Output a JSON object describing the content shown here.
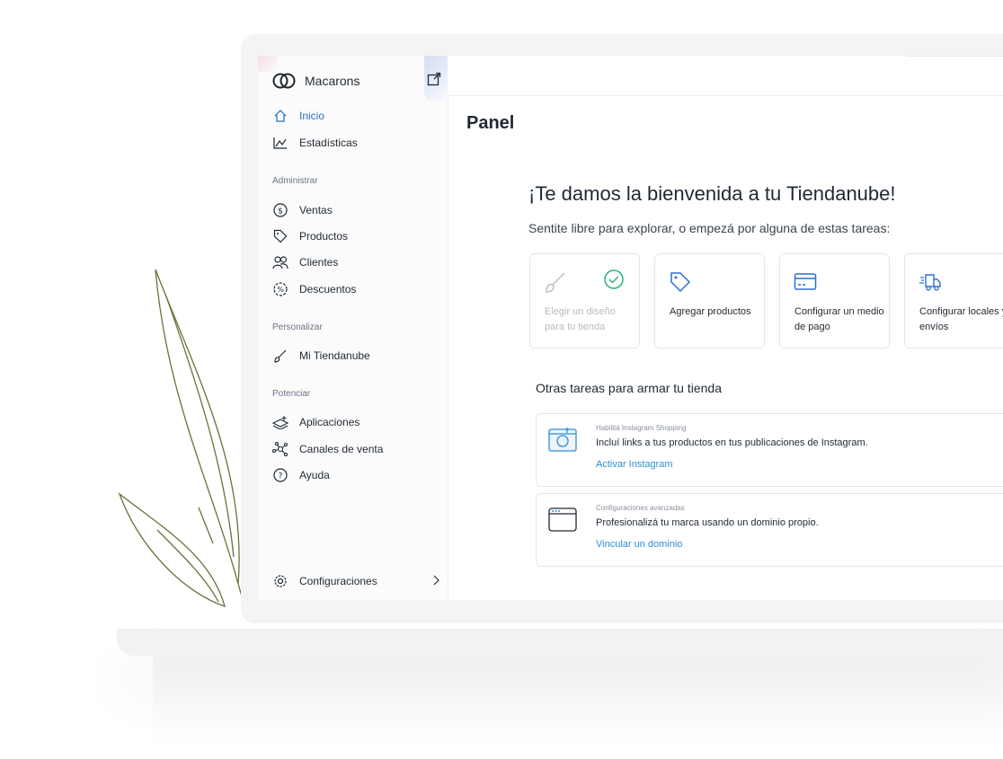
{
  "sidebar": {
    "brand": "Macarons",
    "items_main": [
      {
        "label": "Inicio",
        "icon": "home-icon",
        "active": true
      },
      {
        "label": "Estadísticas",
        "icon": "chart-icon"
      }
    ],
    "section_administrar": "Administrar",
    "items_administrar": [
      {
        "label": "Ventas",
        "icon": "dollar-icon"
      },
      {
        "label": "Productos",
        "icon": "tag-icon"
      },
      {
        "label": "Clientes",
        "icon": "users-icon"
      },
      {
        "label": "Descuentos",
        "icon": "percent-icon"
      }
    ],
    "section_personalizar": "Personalizar",
    "items_personalizar": [
      {
        "label": "Mi Tiendanube",
        "icon": "brush-icon"
      }
    ],
    "section_potenciar": "Potenciar",
    "items_potenciar": [
      {
        "label": "Aplicaciones",
        "icon": "apps-icon"
      },
      {
        "label": "Canales de venta",
        "icon": "network-icon"
      },
      {
        "label": "Ayuda",
        "icon": "help-icon"
      }
    ],
    "settings_label": "Configuraciones"
  },
  "main": {
    "title": "Panel",
    "welcome_title": "¡Te damos la bienvenida a tu Tiendanube!",
    "welcome_subtitle": "Sentite libre para explorar, o empezá por alguna de estas tareas:",
    "tasks": [
      {
        "label": "Elegir un diseño para tu tienda",
        "icon": "brush-icon",
        "done": true
      },
      {
        "label": "Agregar productos",
        "icon": "tag-icon"
      },
      {
        "label": "Configurar un medio de pago",
        "icon": "credit-card-icon"
      },
      {
        "label": "Configurar locales y envíos",
        "icon": "truck-icon"
      }
    ],
    "other_title": "Otras tareas para armar tu tienda",
    "promos": [
      {
        "kicker": "Habilitá Instagram Shopping",
        "desc": "Incluí links a tus productos en tus publicaciones de Instagram.",
        "link": "Activar Instagram",
        "icon": "instagram-icon"
      },
      {
        "kicker": "Configuraciones avanzadas",
        "desc": "Profesionalizá tu marca usando un dominio propio.",
        "link": "Vincular un dominio",
        "icon": "browser-icon"
      }
    ]
  },
  "colors": {
    "accent": "#2f6fd0",
    "link": "#2f8fd0",
    "success": "#2fb27a",
    "leaf": "#5a6a2e"
  }
}
